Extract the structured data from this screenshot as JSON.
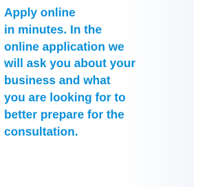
{
  "content": {
    "lines": [
      "Apply online",
      "in minutes. In the",
      "online application we",
      "will ask you about your",
      "business and what",
      "you are looking for to",
      "better prepare for the",
      "consultation."
    ]
  },
  "colors": {
    "text": "#0a8fd8",
    "background": "#ffffff",
    "panel": "#f3f7fb"
  }
}
